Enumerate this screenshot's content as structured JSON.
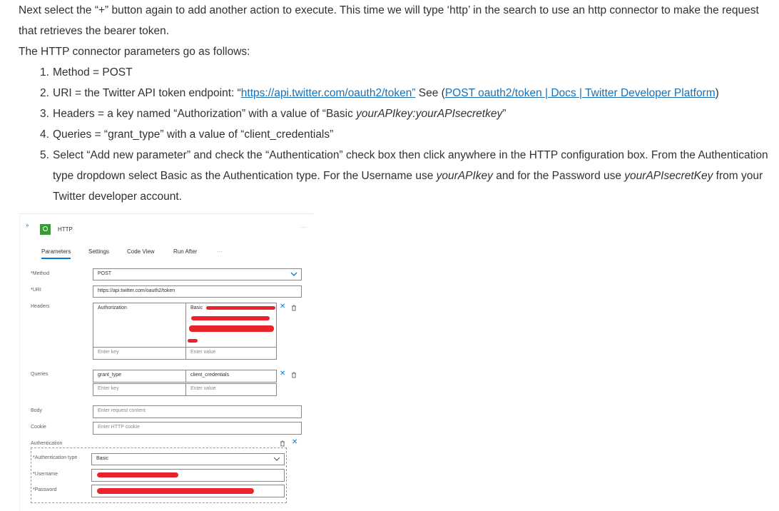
{
  "article": {
    "intro": "Next select the “+” button again to add another action to execute. This time we will type ‘http’ in the search to use an http connector to make the request that retrieves the bearer token.",
    "params_intro": "The HTTP connector parameters go as follows:",
    "steps": {
      "s1": {
        "num": "1.",
        "text": "Method = POST"
      },
      "s2": {
        "num": "2.",
        "pre": "URI = the Twitter API token endpoint: “",
        "url": "https://api.twitter.com/oauth2/token”",
        "mid": " See (",
        "doc_link": "POST oauth2/token | Docs | Twitter Developer Platform",
        "post": ")"
      },
      "s3": {
        "num": "3.",
        "pre": "Headers = a key named “Authorization” with a value of “Basic ",
        "em": "yourAPIkey:yourAPIsecretkey",
        "post": "”"
      },
      "s4": {
        "num": "4.",
        "text": "Queries = “grant_type” with a value of “client_credentials”"
      },
      "s5": {
        "num": "5.",
        "pre": "Select “Add new parameter” and check the “Authentication” check box then click anywhere in the HTTP configuration box. From the Authentication type dropdown select Basic as the Authentication type. For the Username use ",
        "em1": "yourAPIkey",
        "mid": " and for the Password use ",
        "em2": "yourAPIsecretKey",
        "post": " from your Twitter developer account."
      }
    }
  },
  "shot": {
    "title": "HTTP",
    "more": "...",
    "tabs": {
      "parameters": "Parameters",
      "settings": "Settings",
      "code_view": "Code View",
      "run_after": "Run After",
      "more": "···"
    },
    "method": {
      "label": "Method",
      "value": "POST"
    },
    "uri": {
      "label": "URI",
      "value": "https://api.twitter.com/oauth2/token"
    },
    "headers": {
      "label": "Headers",
      "key": "Authorization",
      "value": "Basic",
      "key_ph": "Enter key",
      "value_ph": "Enter value"
    },
    "queries": {
      "label": "Queries",
      "key": "grant_type",
      "value": "client_credentials",
      "key_ph": "Enter key",
      "value_ph": "Enter value"
    },
    "body": {
      "label": "Body",
      "placeholder": "Enter request content"
    },
    "cookie": {
      "label": "Cookie",
      "placeholder": "Enter HTTP cookie"
    },
    "authentication": {
      "label": "Authentication",
      "type_label": "Authentication type",
      "type_value": "Basic",
      "username_label": "Username",
      "password_label": "Password"
    },
    "required_mark": "*",
    "close_glyph": "✕",
    "expand_glyph": "»",
    "colors": {
      "accent": "#0078d4",
      "redact": "#e8232b",
      "logo": "#3a9a3a"
    }
  }
}
